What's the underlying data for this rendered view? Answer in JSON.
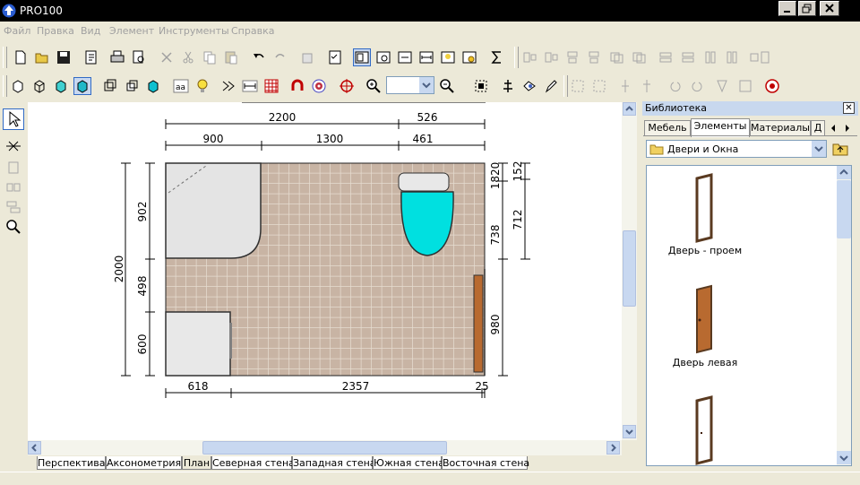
{
  "window": {
    "title": "PRO100"
  },
  "menu": [
    "Файл",
    "Правка",
    "Вид",
    "Элемент",
    "Инструменты",
    "Справка"
  ],
  "zoom": {
    "value": ""
  },
  "plan": {
    "dims_top_row1": [
      "2200",
      "526"
    ],
    "dims_top_row2": [
      "900",
      "1300",
      "461"
    ],
    "dims_left_outer": "2000",
    "dims_left_inner": [
      "902",
      "498",
      "600"
    ],
    "dims_right_row1": [
      "1820",
      "738",
      "980"
    ],
    "dims_right_row2": [
      "152",
      "712"
    ],
    "dims_bottom": [
      "618",
      "2357",
      "25"
    ]
  },
  "view_tabs": [
    "Перспектива",
    "Аксонометрия",
    "План",
    "Северная стена",
    "Западная стена",
    "Южная стена",
    "Восточная стена"
  ],
  "active_view_tab": "План",
  "library": {
    "title": "Библиотека",
    "close": "✕",
    "tabs": [
      "Мебель",
      "Элементы",
      "Материалы",
      "Д"
    ],
    "active_tab": "Элементы",
    "folder": "Двери и Окна",
    "items": [
      {
        "label": "Дверь - проем",
        "style": "frame"
      },
      {
        "label": "Дверь левая",
        "style": "solid"
      },
      {
        "label": "",
        "style": "frame"
      }
    ]
  },
  "colors": {
    "tile": "#c8b4a4",
    "grout": "#e6dcd0",
    "toilet": "#00e0e0",
    "door": "#b86a30"
  },
  "icons": {
    "toolbar1": [
      "new-file-icon",
      "open-folder-icon",
      "save-icon",
      "properties-icon",
      "print-icon",
      "print-preview-icon",
      "cut-icon",
      "scissors-icon",
      "copy-icon",
      "paste-icon",
      "undo-icon",
      "redo-icon",
      "element-properties-icon",
      "checklist-icon",
      "plan-view-icon",
      "zoom-window-icon",
      "fit-icon",
      "measure-icon",
      "light-icon",
      "render-icon",
      "sum-icon"
    ],
    "toolbar2": [
      "cube-icon",
      "cube-outline-icon",
      "cube-cyan-icon",
      "cube-solid-icon",
      "wireframe-cube-icon",
      "cube-small-icon",
      "cube-filled-icon",
      "text-aa-icon",
      "bulb-icon",
      "dimension-icon",
      "ruler-icon",
      "grid-icon",
      "magnet-icon",
      "target-icon",
      "crosshair-icon",
      "zoom-in-icon",
      "zoom-out-icon",
      "select-all-icon",
      "move-icon",
      "rotate-icon",
      "pen-icon"
    ],
    "leftbar": [
      "pointer-icon",
      "stretch-icon",
      "rect-icon",
      "align-icon",
      "distribute-icon",
      "zoom-icon"
    ]
  }
}
